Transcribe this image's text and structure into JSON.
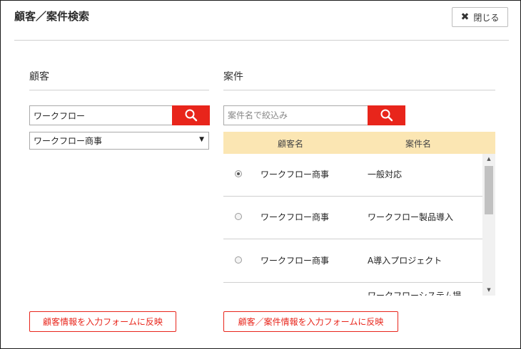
{
  "dialog": {
    "title": "顧客／案件検索",
    "close_label": "閉じる"
  },
  "customer": {
    "section_label": "顧客",
    "search_value": "ワークフロー",
    "selected_option": "ワークフロー商事",
    "apply_label": "顧客情報を入力フォームに反映"
  },
  "project": {
    "section_label": "案件",
    "search_placeholder": "案件名で絞込み",
    "columns": {
      "customer": "顧客名",
      "project": "案件名"
    },
    "rows": [
      {
        "customer": "ワークフロー商事",
        "project": "一般対応",
        "selected": true
      },
      {
        "customer": "ワークフロー商事",
        "project": "ワークフロー製品導入",
        "selected": false
      },
      {
        "customer": "ワークフロー商事",
        "project": "A導入プロジェクト",
        "selected": false
      },
      {
        "customer": "",
        "project": "ワークフローシステム提",
        "selected": false
      }
    ],
    "apply_label": "顧客／案件情報を入力フォームに反映"
  },
  "colors": {
    "accent_red": "#e8251b",
    "grid_header_bg": "#fbe6b3"
  },
  "icons": {
    "search": "magnifier-icon",
    "close": "x-icon"
  }
}
